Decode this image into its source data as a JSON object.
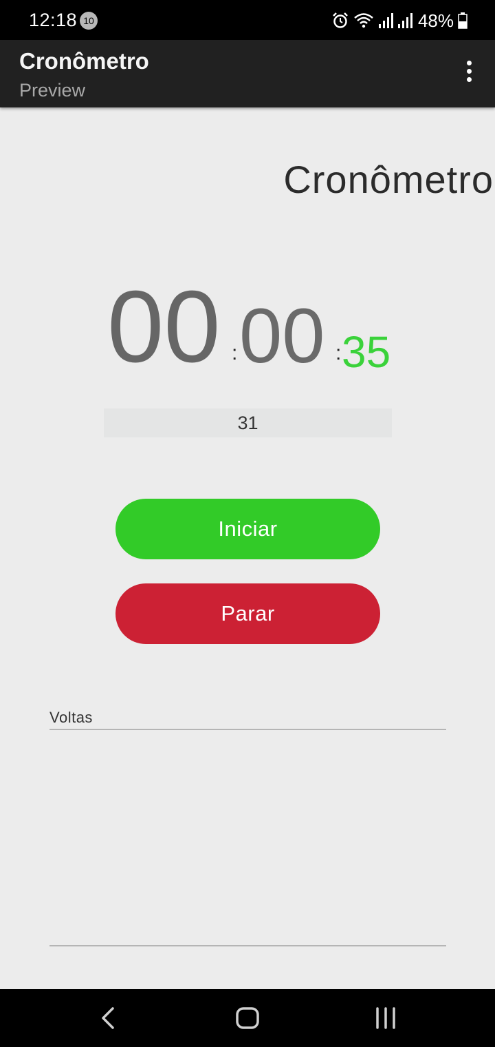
{
  "status_bar": {
    "time": "12:18",
    "notification_count": "10",
    "battery": "48%"
  },
  "app_bar": {
    "title": "Cronômetro",
    "subtitle": "Preview"
  },
  "main": {
    "heading": "Cronômetro",
    "timer": {
      "minutes": "00",
      "seconds": "00",
      "centiseconds": "35",
      "separator": ":"
    },
    "counter": "31",
    "start_label": "Iniciar",
    "stop_label": "Parar",
    "laps_label": "Voltas"
  },
  "colors": {
    "start_button": "#32cb28",
    "stop_button": "#cc2134",
    "centiseconds": "#3ad23a",
    "app_bar": "#212121"
  }
}
